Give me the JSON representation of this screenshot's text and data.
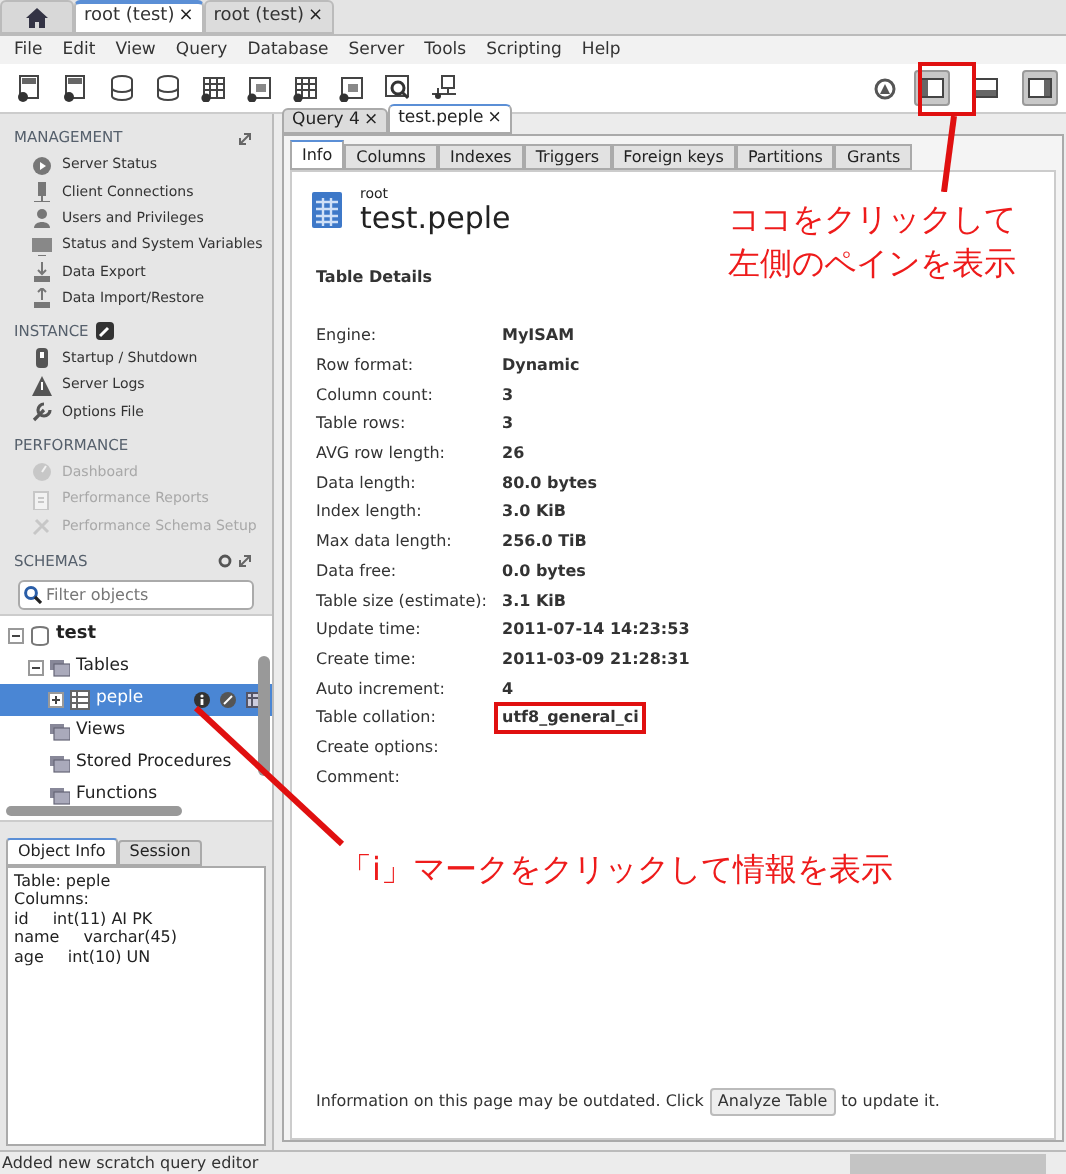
{
  "window_tabs": [
    {
      "label": "root (test)",
      "close": "×",
      "selected": true
    },
    {
      "label": "root (test)",
      "close": "×",
      "selected": false
    }
  ],
  "menu": [
    "File",
    "Edit",
    "View",
    "Query",
    "Database",
    "Server",
    "Tools",
    "Scripting",
    "Help"
  ],
  "pane_toggles": [
    {
      "selected": true
    },
    {
      "selected": false
    },
    {
      "selected": true
    }
  ],
  "sidebar": {
    "sections": [
      {
        "title": "MANAGEMENT",
        "items": [
          {
            "label": "Server Status",
            "disabled": false
          },
          {
            "label": "Client Connections",
            "disabled": false
          },
          {
            "label": "Users and Privileges",
            "disabled": false
          },
          {
            "label": "Status and System Variables",
            "disabled": false
          },
          {
            "label": "Data Export",
            "disabled": false
          },
          {
            "label": "Data Import/Restore",
            "disabled": false
          }
        ]
      },
      {
        "title": "INSTANCE",
        "items": [
          {
            "label": "Startup / Shutdown",
            "disabled": false
          },
          {
            "label": "Server Logs",
            "disabled": false
          },
          {
            "label": "Options File",
            "disabled": false
          }
        ]
      },
      {
        "title": "PERFORMANCE",
        "items": [
          {
            "label": "Dashboard",
            "disabled": true
          },
          {
            "label": "Performance Reports",
            "disabled": true
          },
          {
            "label": "Performance Schema Setup",
            "disabled": true
          }
        ]
      }
    ],
    "schemas": {
      "title": "SCHEMAS",
      "filter_placeholder": "Filter objects",
      "tree": [
        {
          "label": "test",
          "kind": "schema",
          "expanded": true,
          "selected": false,
          "children": [
            {
              "label": "Tables",
              "kind": "folder",
              "expanded": true,
              "selected": false,
              "children": [
                {
                  "label": "peple",
                  "kind": "table",
                  "expanded": false,
                  "selected": true
                }
              ]
            },
            {
              "label": "Views",
              "kind": "folder",
              "selected": false
            },
            {
              "label": "Stored Procedures",
              "kind": "folder",
              "selected": false
            },
            {
              "label": "Functions",
              "kind": "folder",
              "selected": false
            }
          ]
        }
      ]
    }
  },
  "object_info": {
    "tabs": [
      {
        "label": "Object Info",
        "selected": true
      },
      {
        "label": "Session",
        "selected": false
      }
    ],
    "lines": [
      "Table: peple",
      "Columns:"
    ],
    "columns": [
      {
        "name": "id",
        "type": "int(11) AI PK"
      },
      {
        "name": "name",
        "type": "varchar(45)"
      },
      {
        "name": "age",
        "type": "int(10) UN"
      }
    ]
  },
  "doc_tabs": [
    {
      "label": "Query 4",
      "close": "×",
      "selected": false
    },
    {
      "label": "test.peple",
      "close": "×",
      "selected": true
    }
  ],
  "sub_tabs": [
    {
      "label": "Info",
      "selected": true
    },
    {
      "label": "Columns",
      "selected": false
    },
    {
      "label": "Indexes",
      "selected": false
    },
    {
      "label": "Triggers",
      "selected": false
    },
    {
      "label": "Foreign keys",
      "selected": false
    },
    {
      "label": "Partitions",
      "selected": false
    },
    {
      "label": "Grants",
      "selected": false
    }
  ],
  "header": {
    "schema": "root",
    "title": "test.peple"
  },
  "section_title": "Table Details",
  "details": [
    {
      "label": "Engine:",
      "value": "MyISAM",
      "highlighted": false
    },
    {
      "label": "Row format:",
      "value": "Dynamic",
      "highlighted": false
    },
    {
      "label": "Column count:",
      "value": "3",
      "highlighted": false
    },
    {
      "label": "Table rows:",
      "value": "3",
      "highlighted": false
    },
    {
      "label": "AVG row length:",
      "value": "26",
      "highlighted": false
    },
    {
      "label": "Data length:",
      "value": "80.0 bytes",
      "highlighted": false
    },
    {
      "label": "Index length:",
      "value": "3.0 KiB",
      "highlighted": false
    },
    {
      "label": "Max data length:",
      "value": "256.0 TiB",
      "highlighted": false
    },
    {
      "label": "Data free:",
      "value": "0.0 bytes",
      "highlighted": false
    },
    {
      "label": "Table size (estimate):",
      "value": "3.1 KiB",
      "highlighted": false
    },
    {
      "label": "Update time:",
      "value": "2011-07-14 14:23:53",
      "highlighted": false
    },
    {
      "label": "Create time:",
      "value": "2011-03-09 21:28:31",
      "highlighted": false
    },
    {
      "label": "Auto increment:",
      "value": "4",
      "highlighted": false
    },
    {
      "label": "Table collation:",
      "value": "utf8_general_ci",
      "highlighted": true
    },
    {
      "label": "Create options:",
      "highlighted": false
    },
    {
      "label": "Comment:",
      "highlighted": false
    }
  ],
  "footer": {
    "before": "Information on this page may be outdated. Click",
    "button": "Analyze Table",
    "after": "to update it."
  },
  "status_bar": "Added new scratch query editor",
  "annotations": [
    {
      "lines": [
        "ココをクリックして",
        "左側のペインを表示"
      ]
    },
    {
      "lines": [
        "「i」マークをクリックして情報を表示"
      ]
    }
  ]
}
